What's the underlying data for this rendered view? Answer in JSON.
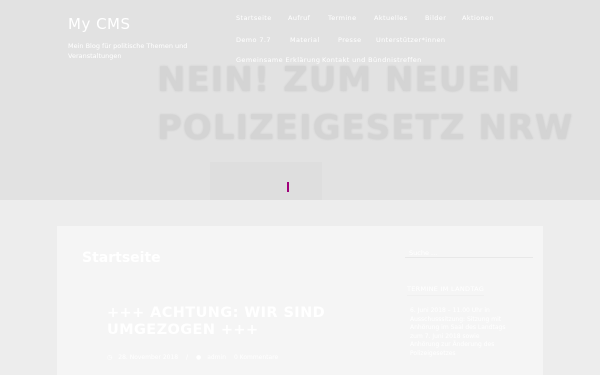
{
  "header": {
    "site_title": "My CMS",
    "site_description": "Mein Blog für politische Themen und Veranstaltungen"
  },
  "hero": {
    "banner_line1": "NEIN! ZUM NEUEN",
    "banner_line2": "POLIZEIGESETZ NRW"
  },
  "nav": {
    "items": [
      "Startseite",
      "Aufruf",
      "Termine",
      "Aktuelles",
      "Bilder",
      "Aktionen",
      "Demo 7.7",
      "Material",
      "Presse",
      "Unterstützer*innen",
      "Gemeinsame Erklärung",
      "Kontakt und Bündnistreffen"
    ]
  },
  "main": {
    "page_title": "Startseite",
    "post": {
      "title": "+++ ACHTUNG: WIR SIND UMGEZOGEN +++",
      "date": "28. November 2018",
      "author": "admin",
      "comments": "0 Kommentare"
    }
  },
  "sidebar": {
    "search_placeholder": "Suche ...",
    "widget_title": "TERMINE IM LANDTAG",
    "widget_items": [
      "6. Juni 2018 – 11.00 Uhr in",
      "Ausschusssitzung: Sitzung mit",
      "Anhörung im Saal des Landtags",
      "zum 7. Juni 2018 sowie",
      "Anhörung zur Änderung des",
      "Polizeigesetzes"
    ]
  },
  "colors": {
    "accent": "#a0007a",
    "hero_bg": "#e2e2e2",
    "card_bg": "#f5f5f5"
  }
}
